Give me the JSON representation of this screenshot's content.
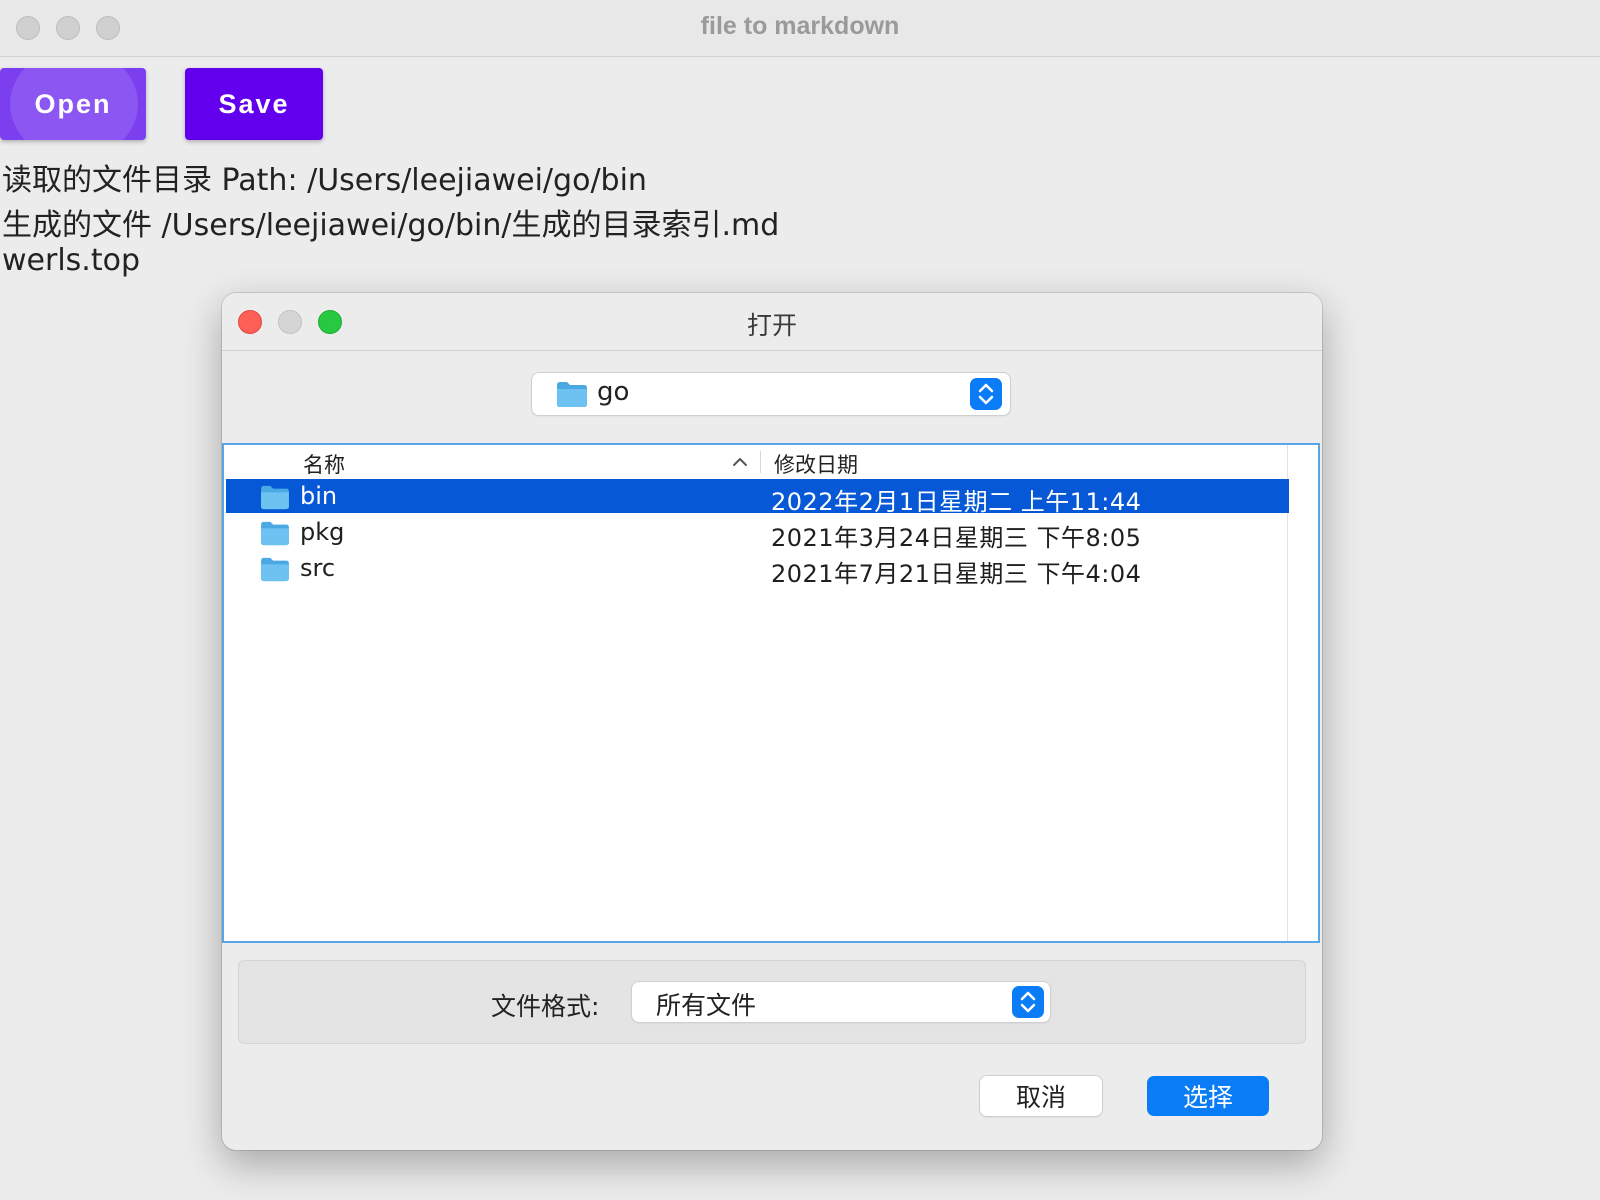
{
  "window": {
    "title": "file to markdown"
  },
  "toolbar": {
    "open_label": "Open",
    "save_label": "Save"
  },
  "info": {
    "read_dir": "读取的文件目录 Path: /Users/leejiawei/go/bin",
    "output_file": "生成的文件 /Users/leejiawei/go/bin/生成的目录索引.md",
    "site": "werls.top"
  },
  "dialog": {
    "title": "打开",
    "location": "go",
    "columns": {
      "name": "名称",
      "modified": "修改日期"
    },
    "files": [
      {
        "name": "bin",
        "modified": "2022年2月1日星期二 上午11:44",
        "selected": true
      },
      {
        "name": "pkg",
        "modified": "2021年3月24日星期三 下午8:05",
        "selected": false
      },
      {
        "name": "src",
        "modified": "2021年7月21日星期三 下午4:04",
        "selected": false
      }
    ],
    "format_label": "文件格式:",
    "format_value": "所有文件",
    "cancel_label": "取消",
    "choose_label": "选择"
  },
  "colors": {
    "open_button": "#7b3ff0",
    "save_button": "#6200ee",
    "selection": "#0758d6",
    "accent": "#0a7cf5",
    "close_red": "#fe5f57",
    "zoom_green": "#28c840"
  },
  "icons": [
    "folder-icon",
    "chevron-updown-icon",
    "sort-ascending-icon"
  ]
}
